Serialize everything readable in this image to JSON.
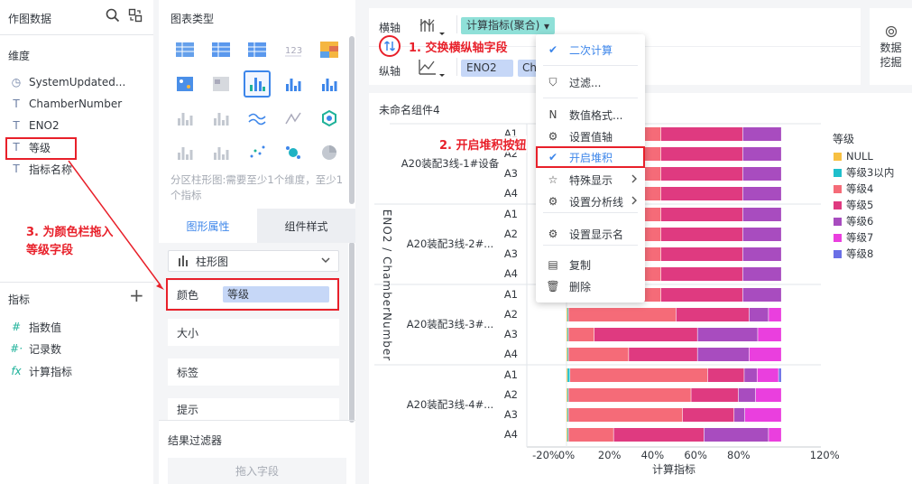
{
  "left_panel": {
    "title": "作图数据",
    "dimension_header": "维度",
    "dimensions": [
      {
        "icon": "clock-icon",
        "glyph": "◷",
        "label": "SystemUpdated..."
      },
      {
        "icon": "text-type-icon",
        "glyph": "T",
        "label": "ChamberNumber"
      },
      {
        "icon": "text-type-icon",
        "glyph": "T",
        "label": "ENO2"
      },
      {
        "icon": "text-type-icon",
        "glyph": "T",
        "label": "等级"
      },
      {
        "icon": "text-type-icon",
        "glyph": "T",
        "label": "指标名称"
      }
    ],
    "measure_header": "指标",
    "add_glyph": "+",
    "measures": [
      {
        "icon": "number-icon",
        "glyph": "#",
        "label": "指数值"
      },
      {
        "icon": "count-icon",
        "glyph": "#·",
        "label": "记录数"
      },
      {
        "icon": "formula-icon",
        "glyph": "fx",
        "label": "计算指标"
      }
    ]
  },
  "mid_panel": {
    "chart_type_title": "图表类型",
    "hint": "分区柱形图:需要至少1个维度，至少1个指标",
    "tabs": [
      "图形属性",
      "组件样式"
    ],
    "chart_select": "柱形图",
    "props": {
      "color_label": "颜色",
      "color_value": "等级",
      "size": "大小",
      "label": "标签",
      "tooltip": "提示"
    },
    "filter_title": "结果过滤器",
    "drag_placeholder": "拖入字段"
  },
  "toolbar": {
    "x_axis_label": "横轴",
    "y_axis_label": "纵轴",
    "x_pill": "计算指标(聚合)",
    "y_pills": [
      "ENO2",
      "Ch"
    ],
    "data_mining": "数据\n挖掘"
  },
  "context_menu": {
    "items": [
      {
        "icon": "check-icon",
        "glyph": "✔",
        "label": "二次计算",
        "checked": true
      },
      {
        "icon": "filter-icon",
        "glyph": "⛉",
        "label": "过滤..."
      },
      {
        "icon": "number-format-icon",
        "glyph": "N",
        "label": "数值格式..."
      },
      {
        "icon": "gear-icon",
        "glyph": "⚙",
        "label": "设置值轴"
      },
      {
        "icon": "check-icon",
        "glyph": "✔",
        "label": "开启堆积",
        "checked": true,
        "highlighted": true
      },
      {
        "icon": "star-icon",
        "glyph": "☆",
        "label": "特殊显示",
        "submenu": true
      },
      {
        "icon": "gear-icon",
        "glyph": "⚙",
        "label": "设置分析线",
        "submenu": true
      },
      {
        "icon": "gear-icon",
        "glyph": "⚙",
        "label": "设置显示名"
      },
      {
        "icon": "copy-icon",
        "glyph": "▤",
        "label": "复制"
      },
      {
        "icon": "trash-icon",
        "glyph": "🗑",
        "label": "删除"
      }
    ]
  },
  "annotations": {
    "a1": "1. 交换横纵轴字段",
    "a2": "2. 开启堆积按钮",
    "a3_line1": "3. 为颜色栏拖入",
    "a3_line2": "等级字段"
  },
  "component_title": "未命名组件4",
  "colors": {
    "accent": "#3d86ea",
    "pill_teal": "#8fe0d8",
    "pill_blue": "#c6d7f7",
    "annotation_red": "#e8202a"
  },
  "chart_data": {
    "type": "bar",
    "orientation": "horizontal",
    "stacked": true,
    "y_axis_title": "ENO2 / ChamberNumber",
    "x_axis_title": "计算指标",
    "x_ticks": [
      "-20%",
      "0%",
      "20%",
      "40%",
      "60%",
      "80%",
      "120%"
    ],
    "xlim": [
      -0.2,
      1.2
    ],
    "legend_title": "等级",
    "legend_position": "right",
    "legend": [
      {
        "name": "NULL",
        "color": "#f7c042"
      },
      {
        "name": "等级3以内",
        "color": "#1fbfcc"
      },
      {
        "name": "等级4",
        "color": "#f56b78"
      },
      {
        "name": "等级5",
        "color": "#df3a80"
      },
      {
        "name": "等级6",
        "color": "#a84cbf"
      },
      {
        "name": "等级7",
        "color": "#ea3fde"
      },
      {
        "name": "等级8",
        "color": "#6a6fe6"
      }
    ],
    "groups": [
      {
        "label": "A20装配3线-1#设备",
        "rows": [
          {
            "chamber": "A1",
            "segments": [
              0,
              0,
              0.44,
              0.38,
              0.18,
              0,
              0
            ]
          },
          {
            "chamber": "A2",
            "segments": [
              0,
              0,
              0.44,
              0.38,
              0.18,
              0,
              0
            ]
          },
          {
            "chamber": "A3",
            "segments": [
              0,
              0,
              0.44,
              0.38,
              0.18,
              0,
              0
            ]
          },
          {
            "chamber": "A4",
            "segments": [
              0,
              0,
              0.44,
              0.38,
              0.18,
              0,
              0
            ]
          }
        ]
      },
      {
        "label": "A20装配3线-2#...",
        "rows": [
          {
            "chamber": "A1",
            "segments": [
              0,
              0,
              0.44,
              0.38,
              0.18,
              0,
              0
            ]
          },
          {
            "chamber": "A2",
            "segments": [
              0,
              0,
              0.44,
              0.38,
              0.18,
              0,
              0
            ]
          },
          {
            "chamber": "A3",
            "segments": [
              0,
              0,
              0.44,
              0.38,
              0.18,
              0,
              0
            ]
          },
          {
            "chamber": "A4",
            "segments": [
              0,
              0,
              0.44,
              0.38,
              0.18,
              0,
              0
            ]
          }
        ]
      },
      {
        "label": "A20装配3线-3#...",
        "rows": [
          {
            "chamber": "A1",
            "segments": [
              0,
              0,
              0.44,
              0.38,
              0.18,
              0,
              0
            ]
          },
          {
            "chamber": "A2",
            "segments": [
              0.005,
              0.005,
              0.5,
              0.34,
              0.09,
              0.06,
              0
            ]
          },
          {
            "chamber": "A3",
            "segments": [
              0.005,
              0.005,
              0.12,
              0.48,
              0.28,
              0.11,
              0
            ]
          },
          {
            "chamber": "A4",
            "segments": [
              0.005,
              0.005,
              0.28,
              0.32,
              0.24,
              0.15,
              0
            ]
          }
        ]
      },
      {
        "label": "A20装配3线-4#...",
        "rows": [
          {
            "chamber": "A1",
            "segments": [
              0.005,
              0.012,
              0.64,
              0.17,
              0.06,
              0.1,
              0.013
            ]
          },
          {
            "chamber": "A2",
            "segments": [
              0.005,
              0.005,
              0.57,
              0.22,
              0.08,
              0.12,
              0
            ]
          },
          {
            "chamber": "A3",
            "segments": [
              0.005,
              0.005,
              0.53,
              0.24,
              0.05,
              0.17,
              0
            ]
          },
          {
            "chamber": "A4",
            "segments": [
              0.005,
              0.005,
              0.21,
              0.42,
              0.3,
              0.06,
              0
            ]
          }
        ]
      }
    ]
  }
}
